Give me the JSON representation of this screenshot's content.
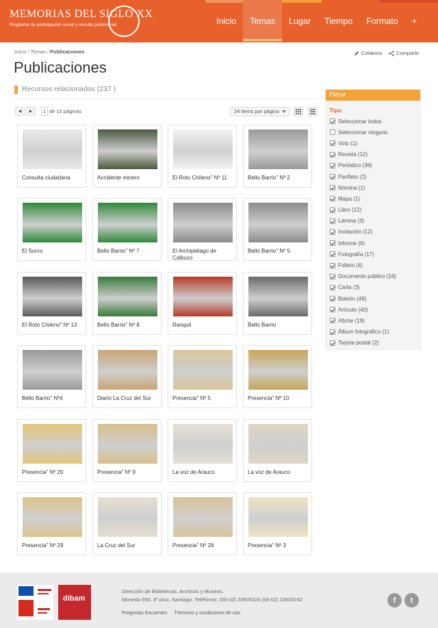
{
  "header": {
    "logo_title": "MEMORIAS DEL SIGLO XX",
    "logo_subtitle": "Programa de participación social y rescate patrimonial",
    "strip_colors": [
      "#f5935f",
      "#f2a237",
      "#e8612c",
      "#d94a28"
    ],
    "nav": [
      "Inicio",
      "Temas",
      "Lugar",
      "Tiempo",
      "Formato",
      "+"
    ],
    "active_nav": "Temas"
  },
  "breadcrumb": {
    "home": "Inicio",
    "sep": "/",
    "parent": "Temas",
    "current": "Publicaciones"
  },
  "actions": {
    "collaborate": "Colabora",
    "share": "Comparte"
  },
  "page_title": "Publicaciones",
  "section": {
    "label": "Recursos relacionados (237 )"
  },
  "pager": {
    "prev": "◀",
    "next": "▶",
    "page": "1",
    "of_label": "de 10 páginas"
  },
  "per_page": {
    "value": "24 items por página"
  },
  "items": [
    {
      "label": "Consulta ciudadana",
      "tone": "#e9e9e9"
    },
    {
      "label": "Accidente minero",
      "tone": "#4b5a3e"
    },
    {
      "label": "El Roto Chileno\" Nº 11",
      "tone": "#f3f3f3"
    },
    {
      "label": "Bello Barrio\" Nº 2",
      "tone": "#9a9a9a"
    },
    {
      "label": "El Surco",
      "tone": "#2f8a3a"
    },
    {
      "label": "Bello Barrio\" Nº 7",
      "tone": "#2f8a3a"
    },
    {
      "label": "El Archipiélago de Calbuco",
      "tone": "#8a8a8a"
    },
    {
      "label": "Bello Barrio\" Nº 5",
      "tone": "#8c8c8c"
    },
    {
      "label": "El Roto Chileno\" Nº 13",
      "tone": "#5a5a5a"
    },
    {
      "label": "Bello Barrio\" Nº 8",
      "tone": "#3a7a3a"
    },
    {
      "label": "Ranquil",
      "tone": "#b43a2a"
    },
    {
      "label": "Bello Barrio",
      "tone": "#6a6a6a"
    },
    {
      "label": "Bello Barrio\" Nº4",
      "tone": "#9a9a9a"
    },
    {
      "label": "Diario La Cruz del Sur",
      "tone": "#c9a574"
    },
    {
      "label": "Presencia\" Nº 5",
      "tone": "#d9c69a"
    },
    {
      "label": "Presencia\" Nº 10",
      "tone": "#c8a55a"
    },
    {
      "label": "Presencia\" Nº 20",
      "tone": "#e4c67a"
    },
    {
      "label": "Presencia\" Nº 9",
      "tone": "#d8c08a"
    },
    {
      "label": "La voz de Arauco",
      "tone": "#e5e0d4"
    },
    {
      "label": "La voz de Arauco",
      "tone": "#ddd6c3"
    },
    {
      "label": "Presencia\" Nº 29",
      "tone": "#dcc58c"
    },
    {
      "label": "La Cruz del Sur",
      "tone": "#e6e0d2"
    },
    {
      "label": "Presencia\" Nº 28",
      "tone": "#d9c49a"
    },
    {
      "label": "Presencia\" Nº 3",
      "tone": "#f0e2c2"
    }
  ],
  "filter": {
    "title": "Filtrar",
    "type_label": "Tipo",
    "options": [
      {
        "label": "Seleccionar todos",
        "checked": true
      },
      {
        "label": "Seleccionar ninguno",
        "checked": false
      },
      {
        "label": "Voto (1)",
        "checked": true
      },
      {
        "label": "Revista (12)",
        "checked": true
      },
      {
        "label": "Periódico (36)",
        "checked": true
      },
      {
        "label": "Panfleto (2)",
        "checked": true
      },
      {
        "label": "Nómina (1)",
        "checked": true
      },
      {
        "label": "Mapa (1)",
        "checked": true
      },
      {
        "label": "Libro (12)",
        "checked": true
      },
      {
        "label": "Lámina (3)",
        "checked": true
      },
      {
        "label": "Invitación (12)",
        "checked": true
      },
      {
        "label": "Informe (6)",
        "checked": true
      },
      {
        "label": "Fotografía (17)",
        "checked": true
      },
      {
        "label": "Folleto (4)",
        "checked": true
      },
      {
        "label": "Documento público (16)",
        "checked": true
      },
      {
        "label": "Carta (3)",
        "checked": true
      },
      {
        "label": "Boletín (49)",
        "checked": true
      },
      {
        "label": "Artículo (40)",
        "checked": true
      },
      {
        "label": "Afiche (19)",
        "checked": true
      },
      {
        "label": "Álbum fotográfico (1)",
        "checked": true
      },
      {
        "label": "Tarjeta postal (2)",
        "checked": true
      }
    ]
  },
  "footer": {
    "line1": "Dirección de Bibliotecas, Archivos y Museos.",
    "line2": "Moneda 650, 4º piso, Santiago. Teléfonos: (56-02) 23605324 (56-02) 23605242",
    "link_faq": "Preguntas frecuentes",
    "link_terms": "Términos y condiciones de uso",
    "dibam_logo": "dibam",
    "facebook_glyph": "f",
    "twitter_glyph": "t"
  },
  "colors": {
    "brand": "#e8612c",
    "accent": "#f2a237",
    "dibam": "#c4272c"
  }
}
